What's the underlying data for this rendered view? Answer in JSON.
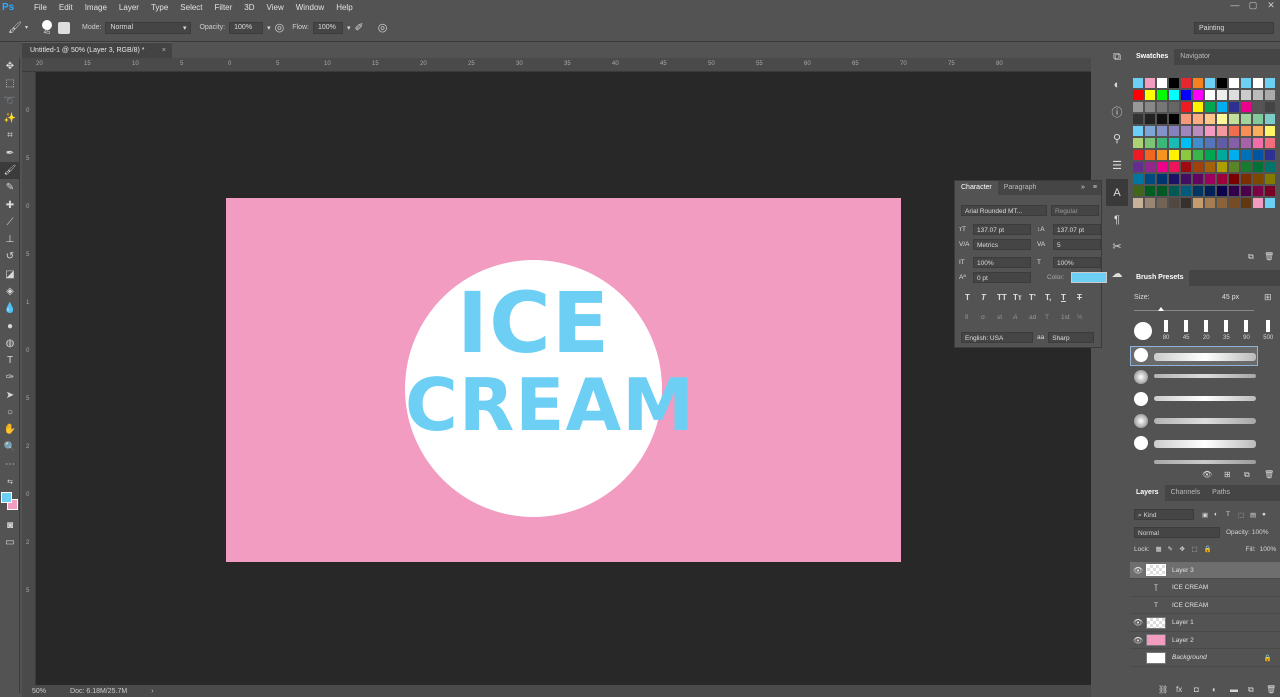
{
  "app": {
    "logo": "Ps"
  },
  "menu": [
    "File",
    "Edit",
    "Image",
    "Layer",
    "Type",
    "Select",
    "Filter",
    "3D",
    "View",
    "Window",
    "Help"
  ],
  "window_controls": [
    "—",
    "▢",
    "✕"
  ],
  "options": {
    "brush_size": "45",
    "mode_label": "Mode:",
    "mode_value": "Normal",
    "opacity_label": "Opacity:",
    "opacity_value": "100%",
    "flow_label": "Flow:",
    "flow_value": "100%",
    "workspace": "Painting"
  },
  "document": {
    "tab_title": "Untitled-1 @ 50% (Layer 3, RGB/8) *",
    "close": "×",
    "art_line1": "ICE",
    "art_line2": "CREAM",
    "background_color": "#f29cc2",
    "text_color": "#6ecff5"
  },
  "ruler_h": [
    "20",
    "15",
    "10",
    "5",
    "0",
    "5",
    "10",
    "15",
    "20",
    "25",
    "30",
    "35",
    "40",
    "45",
    "50",
    "55",
    "60",
    "65",
    "70",
    "75",
    "80"
  ],
  "ruler_v": [
    "0",
    "5",
    "0",
    "5",
    "1",
    "0",
    "5",
    "2",
    "0",
    "2",
    "5"
  ],
  "status": {
    "zoom": "50%",
    "doc": "Doc: 6.18M/25.7M",
    "arrow": "›"
  },
  "character_panel": {
    "tab_character": "Character",
    "tab_paragraph": "Paragraph",
    "font_family": "Arial Rounded MT...",
    "font_style": "Regular",
    "font_size": "137.07 pt",
    "leading": "137.07 pt",
    "kerning": "Metrics",
    "tracking": "5",
    "vscale": "100%",
    "hscale": "100%",
    "baseline": "0 pt",
    "color_label": "Color:",
    "color": "#6ecff5",
    "language": "English: USA",
    "antialias_icon": "aa",
    "antialias": "Sharp",
    "style_buttons": [
      "T",
      "T",
      "TT",
      "Tт",
      "T'",
      "T,",
      "T",
      "T"
    ],
    "glyph_buttons": [
      "fi",
      "σ",
      "st",
      "A",
      "ad",
      "T",
      "1st",
      "½"
    ]
  },
  "swatches": {
    "tab_swatches": "Swatches",
    "tab_navigator": "Navigator",
    "colors": [
      "#6ecff5",
      "#f29cc2",
      "#ffffff",
      "#000000",
      "#e8262e",
      "#f5821f",
      "#6ecff5",
      "#000000",
      "#ffffff",
      "#6ecff5",
      "#ffffff",
      "#6ecff5",
      "#ff0000",
      "#ffff00",
      "#00ff00",
      "#00ffff",
      "#0000ff",
      "#ff00ff",
      "#ffffff",
      "#eeeeee",
      "#dddddd",
      "#cccccc",
      "#bbbbbb",
      "#aaaaaa",
      "#999999",
      "#888888",
      "#777777",
      "#666666",
      "#ed1c24",
      "#fff200",
      "#00a651",
      "#00aeef",
      "#2e3192",
      "#ec008c",
      "#555555",
      "#444444",
      "#333333",
      "#222222",
      "#111111",
      "#000000",
      "#f7977a",
      "#f9ad81",
      "#fdc68a",
      "#fff79a",
      "#c4df9b",
      "#a3d39c",
      "#82ca9d",
      "#7bcdc8",
      "#6dcff6",
      "#7da7d9",
      "#8393ca",
      "#8781bd",
      "#a186be",
      "#bd8cbf",
      "#f49ac1",
      "#f5989d",
      "#f26c4f",
      "#f68e56",
      "#fbaf5d",
      "#fff568",
      "#acd373",
      "#7cc576",
      "#3bb878",
      "#1abbb4",
      "#00bff3",
      "#438ccb",
      "#5574b9",
      "#605ca8",
      "#855fa8",
      "#a763a8",
      "#f06eaa",
      "#f26d7d",
      "#ed1c24",
      "#f26522",
      "#f7941d",
      "#fff200",
      "#8dc63f",
      "#39b54a",
      "#00a651",
      "#00a99d",
      "#00aeef",
      "#0072bc",
      "#0054a6",
      "#2e3192",
      "#662d91",
      "#92278f",
      "#ec008c",
      "#ed145b",
      "#9e0b0f",
      "#a0410d",
      "#a3620a",
      "#aba000",
      "#598527",
      "#197b30",
      "#007236",
      "#00746b",
      "#0076a3",
      "#004a80",
      "#003471",
      "#1b1464",
      "#440e62",
      "#630460",
      "#9e005d",
      "#9e0039",
      "#790000",
      "#7b2e00",
      "#7d4900",
      "#827b00",
      "#406618",
      "#005e20",
      "#005826",
      "#005952",
      "#005b7f",
      "#003663",
      "#002157",
      "#0d004c",
      "#32004b",
      "#4b0049",
      "#7b0046",
      "#7a0026",
      "#c7b299",
      "#998675",
      "#736357",
      "#534741",
      "#37302d",
      "#c69c6d",
      "#a67c52",
      "#8c6239",
      "#754c24",
      "#603913",
      "#f29cc2",
      "#6ecff5"
    ]
  },
  "brush_presets": {
    "title": "Brush Presets",
    "size_label": "Size:",
    "size_value": "45 px",
    "sizes": [
      "80",
      "45",
      "20",
      "35",
      "90",
      "500"
    ]
  },
  "layers": {
    "tab_layers": "Layers",
    "tab_channels": "Channels",
    "tab_paths": "Paths",
    "filter": "Kind",
    "blend": "Normal",
    "opacity_label": "Opacity:",
    "opacity_value": "100%",
    "lock_label": "Lock:",
    "fill_label": "Fill:",
    "fill_value": "100%",
    "items": [
      {
        "name": "Layer 3",
        "visible": true,
        "type": "pixel",
        "selected": true
      },
      {
        "name": "ICE CREAM",
        "visible": false,
        "type": "warped-text"
      },
      {
        "name": "ICE CREAM",
        "visible": false,
        "type": "text"
      },
      {
        "name": "Layer 1",
        "visible": true,
        "type": "pixel"
      },
      {
        "name": "Layer 2",
        "visible": true,
        "type": "pink"
      },
      {
        "name": "Background",
        "visible": false,
        "type": "white",
        "locked": true
      }
    ]
  }
}
